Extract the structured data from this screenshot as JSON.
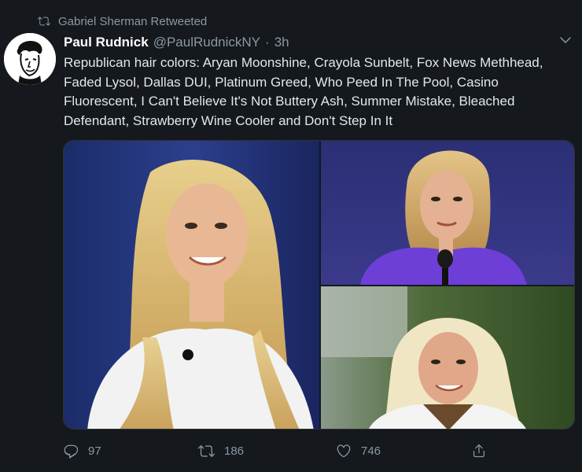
{
  "retweet_banner": {
    "text": "Gabriel Sherman Retweeted",
    "icon": "retweet-icon"
  },
  "tweet": {
    "author": {
      "display_name": "Paul Rudnick",
      "handle": "@PaulRudnickNY",
      "separator": "·",
      "time": "3h"
    },
    "text": "Republican hair colors: Aryan Moonshine, Crayola Sunbelt, Fox News Methhead, Faded Lysol, Dallas DUI, Platinum Greed, Who Peed In The Pool, Casino Fluorescent, I Can't Believe It's Not Buttery Ash, Summer Mistake, Bleached Defendant, Strawberry Wine Cooler and Don't Step In It",
    "media_count": 3
  },
  "actions": {
    "reply": {
      "icon": "reply-icon",
      "count": "97"
    },
    "retweet": {
      "icon": "retweet-icon",
      "count": "186"
    },
    "like": {
      "icon": "heart-icon",
      "count": "746"
    },
    "share": {
      "icon": "share-icon"
    }
  },
  "colors": {
    "background": "#15181c",
    "secondary_text": "#8899a6",
    "primary_text": "#e1e8ed"
  }
}
